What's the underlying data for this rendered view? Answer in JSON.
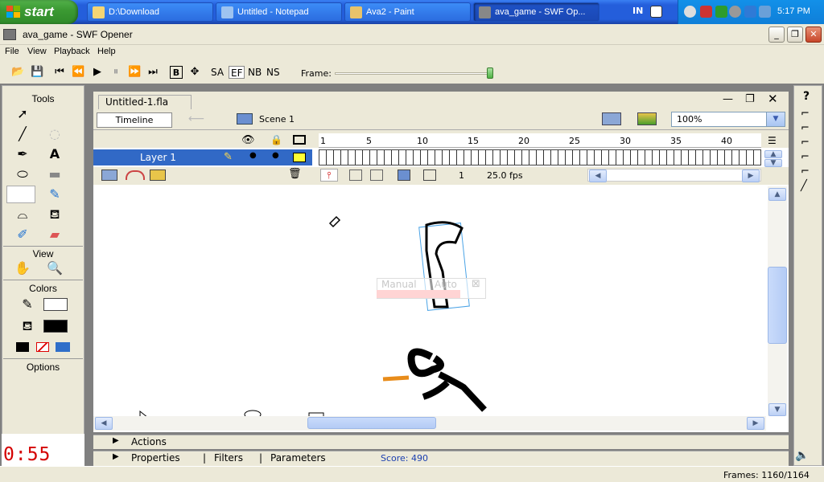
{
  "taskbar": {
    "start_label": "start",
    "items": [
      {
        "label": "D:\\Download"
      },
      {
        "label": "Untitled - Notepad"
      },
      {
        "label": "Ava2 - Paint"
      },
      {
        "label": "ava_game - SWF Op..."
      }
    ],
    "language": "IN",
    "clock": "5:17 PM"
  },
  "window": {
    "title": "ava_game - SWF Opener"
  },
  "menu": [
    "File",
    "View",
    "Playback",
    "Help"
  ],
  "toolbar": {
    "buttons": [
      "SA",
      "EF",
      "NB",
      "NS"
    ],
    "frame_label": "Frame:",
    "frame_progress": 0.98
  },
  "tools_panel": {
    "tools_title": "Tools",
    "view_title": "View",
    "colors_title": "Colors",
    "options_title": "Options"
  },
  "timer": "0:55",
  "document": {
    "tab": "Untitled-1.fla",
    "timeline_button": "Timeline",
    "scene": "Scene 1",
    "zoom": "100%",
    "ruler_ticks": [
      "1",
      "5",
      "10",
      "15",
      "20",
      "25",
      "30",
      "35",
      "40"
    ],
    "layer_name": "Layer 1",
    "frame_number": "1",
    "fps": "25.0 fps",
    "overlay_manual": "Manual",
    "overlay_auto": "Auto"
  },
  "panels": {
    "actions": "Actions",
    "properties": "Properties",
    "filters": "Filters",
    "parameters": "Parameters",
    "score": "Score: 490"
  },
  "status": {
    "frames": "Frames: 1160/1164"
  },
  "colors": {
    "layer_highlight": "#3169c6",
    "timer": "#d40000",
    "score": "#1b3fb0"
  }
}
